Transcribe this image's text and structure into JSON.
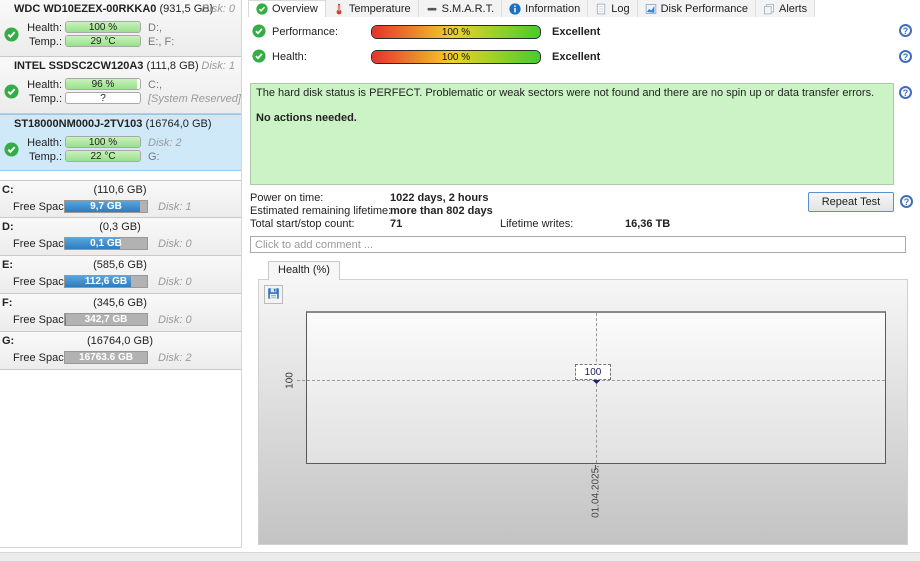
{
  "sidebar": {
    "disks": [
      {
        "name": "WDC WD10EZEX-00RKKA0",
        "size": "(931,5 GB)",
        "disk": "Disk: 0",
        "health_label": "Health:",
        "health_value": "100 %",
        "health_pct": 100,
        "health_right": "D:,",
        "temp_label": "Temp.:",
        "temp_value": "29 °C",
        "temp_pct": 100,
        "temp_right": "E:, F:"
      },
      {
        "name": "INTEL SSDSC2CW120A3",
        "size": "(111,8 GB)",
        "disk": "Disk: 1",
        "health_label": "Health:",
        "health_value": "96 %",
        "health_pct": 96,
        "health_right": "C:,",
        "temp_label": "Temp.:",
        "temp_value": "?",
        "temp_pct": 0,
        "temp_right": "[System Reserved]"
      },
      {
        "name": "ST18000NM000J-2TV103",
        "size": "(16764,0 GB)",
        "disk": "",
        "health_label": "Health:",
        "health_value": "100 %",
        "health_pct": 100,
        "health_right": "Disk: 2",
        "temp_label": "Temp.:",
        "temp_value": "22 °C",
        "temp_pct": 100,
        "temp_right": "G:"
      }
    ],
    "volumes": [
      {
        "letter": "C:",
        "size": "(110,6 GB)",
        "free_label": "Free Space",
        "free_value": "9,7 GB",
        "disk": "Disk: 1",
        "used_pct": 91
      },
      {
        "letter": "D:",
        "size": "(0,3 GB)",
        "free_label": "Free Space",
        "free_value": "0,1 GB",
        "disk": "Disk: 0",
        "used_pct": 67
      },
      {
        "letter": "E:",
        "size": "(585,6 GB)",
        "free_label": "Free Space",
        "free_value": "112,6 GB",
        "disk": "Disk: 0",
        "used_pct": 81
      },
      {
        "letter": "F:",
        "size": "(345,6 GB)",
        "free_label": "Free Space",
        "free_value": "342,7 GB",
        "disk": "Disk: 0",
        "used_pct": 1
      },
      {
        "letter": "G:",
        "size": "(16764,0 GB)",
        "free_label": "Free Space",
        "free_value": "16763.6 GB",
        "disk": "Disk: 2",
        "used_pct": 0
      }
    ]
  },
  "tabs": [
    {
      "label": "Overview",
      "icon": "check-circle-icon"
    },
    {
      "label": "Temperature",
      "icon": "thermometer-icon"
    },
    {
      "label": "S.M.A.R.T.",
      "icon": "smart-icon"
    },
    {
      "label": "Information",
      "icon": "info-icon"
    },
    {
      "label": "Log",
      "icon": "document-icon"
    },
    {
      "label": "Disk Performance",
      "icon": "chart-icon"
    },
    {
      "label": "Alerts",
      "icon": "pages-icon"
    }
  ],
  "overview": {
    "performance_label": "Performance:",
    "performance_value": "100 %",
    "performance_pct": 100,
    "performance_rating": "Excellent",
    "health_label": "Health:",
    "health_value": "100 %",
    "health_pct": 100,
    "health_rating": "Excellent",
    "status_text": "The hard disk status is PERFECT. Problematic or weak sectors were not found and there are no spin up or data transfer errors.",
    "status_action": "No actions needed.",
    "stats": {
      "power_on_label": "Power on time:",
      "power_on_value": "1022 days, 2 hours",
      "lifetime_label": "Estimated remaining lifetime:",
      "lifetime_value": "more than 802 days",
      "startstop_label": "Total start/stop count:",
      "startstop_value": "71",
      "writes_label": "Lifetime writes:",
      "writes_value": "16,36 TB"
    },
    "repeat_test_label": "Repeat Test",
    "comment_placeholder": "Click to add comment ...",
    "chart_tab_label": "Health (%)"
  },
  "chart_data": {
    "type": "line",
    "title": "Health (%)",
    "x": [
      "01.04.2025."
    ],
    "series": [
      {
        "name": "Health",
        "values": [
          100
        ]
      }
    ],
    "point_label": "100",
    "y_tick_labels": [
      "100"
    ],
    "grid": "dashed-crosshair",
    "legend": "none"
  },
  "colors": {
    "accent_blue": "#2e7bbf",
    "health_green": "#9be08c",
    "status_green_bg": "#ccf3c6",
    "selected_blue": "#cfe9f9",
    "gradient_bar": [
      "#e5322b",
      "#f1d02a",
      "#43cf2a"
    ]
  }
}
